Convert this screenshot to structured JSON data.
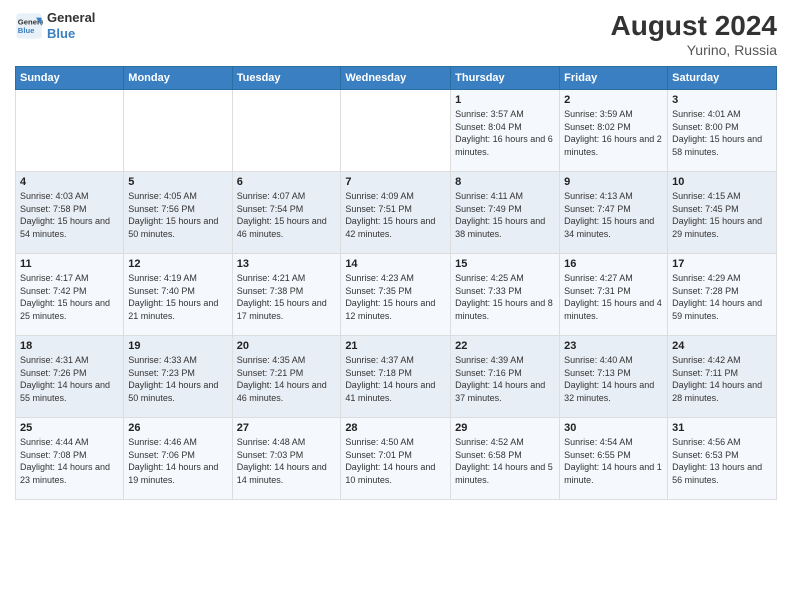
{
  "header": {
    "logo_line1": "General",
    "logo_line2": "Blue",
    "month_year": "August 2024",
    "location": "Yurino, Russia"
  },
  "days_of_week": [
    "Sunday",
    "Monday",
    "Tuesday",
    "Wednesday",
    "Thursday",
    "Friday",
    "Saturday"
  ],
  "weeks": [
    [
      {
        "day": "",
        "info": ""
      },
      {
        "day": "",
        "info": ""
      },
      {
        "day": "",
        "info": ""
      },
      {
        "day": "",
        "info": ""
      },
      {
        "day": "1",
        "info": "Sunrise: 3:57 AM\nSunset: 8:04 PM\nDaylight: 16 hours\nand 6 minutes."
      },
      {
        "day": "2",
        "info": "Sunrise: 3:59 AM\nSunset: 8:02 PM\nDaylight: 16 hours\nand 2 minutes."
      },
      {
        "day": "3",
        "info": "Sunrise: 4:01 AM\nSunset: 8:00 PM\nDaylight: 15 hours\nand 58 minutes."
      }
    ],
    [
      {
        "day": "4",
        "info": "Sunrise: 4:03 AM\nSunset: 7:58 PM\nDaylight: 15 hours\nand 54 minutes."
      },
      {
        "day": "5",
        "info": "Sunrise: 4:05 AM\nSunset: 7:56 PM\nDaylight: 15 hours\nand 50 minutes."
      },
      {
        "day": "6",
        "info": "Sunrise: 4:07 AM\nSunset: 7:54 PM\nDaylight: 15 hours\nand 46 minutes."
      },
      {
        "day": "7",
        "info": "Sunrise: 4:09 AM\nSunset: 7:51 PM\nDaylight: 15 hours\nand 42 minutes."
      },
      {
        "day": "8",
        "info": "Sunrise: 4:11 AM\nSunset: 7:49 PM\nDaylight: 15 hours\nand 38 minutes."
      },
      {
        "day": "9",
        "info": "Sunrise: 4:13 AM\nSunset: 7:47 PM\nDaylight: 15 hours\nand 34 minutes."
      },
      {
        "day": "10",
        "info": "Sunrise: 4:15 AM\nSunset: 7:45 PM\nDaylight: 15 hours\nand 29 minutes."
      }
    ],
    [
      {
        "day": "11",
        "info": "Sunrise: 4:17 AM\nSunset: 7:42 PM\nDaylight: 15 hours\nand 25 minutes."
      },
      {
        "day": "12",
        "info": "Sunrise: 4:19 AM\nSunset: 7:40 PM\nDaylight: 15 hours\nand 21 minutes."
      },
      {
        "day": "13",
        "info": "Sunrise: 4:21 AM\nSunset: 7:38 PM\nDaylight: 15 hours\nand 17 minutes."
      },
      {
        "day": "14",
        "info": "Sunrise: 4:23 AM\nSunset: 7:35 PM\nDaylight: 15 hours\nand 12 minutes."
      },
      {
        "day": "15",
        "info": "Sunrise: 4:25 AM\nSunset: 7:33 PM\nDaylight: 15 hours\nand 8 minutes."
      },
      {
        "day": "16",
        "info": "Sunrise: 4:27 AM\nSunset: 7:31 PM\nDaylight: 15 hours\nand 4 minutes."
      },
      {
        "day": "17",
        "info": "Sunrise: 4:29 AM\nSunset: 7:28 PM\nDaylight: 14 hours\nand 59 minutes."
      }
    ],
    [
      {
        "day": "18",
        "info": "Sunrise: 4:31 AM\nSunset: 7:26 PM\nDaylight: 14 hours\nand 55 minutes."
      },
      {
        "day": "19",
        "info": "Sunrise: 4:33 AM\nSunset: 7:23 PM\nDaylight: 14 hours\nand 50 minutes."
      },
      {
        "day": "20",
        "info": "Sunrise: 4:35 AM\nSunset: 7:21 PM\nDaylight: 14 hours\nand 46 minutes."
      },
      {
        "day": "21",
        "info": "Sunrise: 4:37 AM\nSunset: 7:18 PM\nDaylight: 14 hours\nand 41 minutes."
      },
      {
        "day": "22",
        "info": "Sunrise: 4:39 AM\nSunset: 7:16 PM\nDaylight: 14 hours\nand 37 minutes."
      },
      {
        "day": "23",
        "info": "Sunrise: 4:40 AM\nSunset: 7:13 PM\nDaylight: 14 hours\nand 32 minutes."
      },
      {
        "day": "24",
        "info": "Sunrise: 4:42 AM\nSunset: 7:11 PM\nDaylight: 14 hours\nand 28 minutes."
      }
    ],
    [
      {
        "day": "25",
        "info": "Sunrise: 4:44 AM\nSunset: 7:08 PM\nDaylight: 14 hours\nand 23 minutes."
      },
      {
        "day": "26",
        "info": "Sunrise: 4:46 AM\nSunset: 7:06 PM\nDaylight: 14 hours\nand 19 minutes."
      },
      {
        "day": "27",
        "info": "Sunrise: 4:48 AM\nSunset: 7:03 PM\nDaylight: 14 hours\nand 14 minutes."
      },
      {
        "day": "28",
        "info": "Sunrise: 4:50 AM\nSunset: 7:01 PM\nDaylight: 14 hours\nand 10 minutes."
      },
      {
        "day": "29",
        "info": "Sunrise: 4:52 AM\nSunset: 6:58 PM\nDaylight: 14 hours\nand 5 minutes."
      },
      {
        "day": "30",
        "info": "Sunrise: 4:54 AM\nSunset: 6:55 PM\nDaylight: 14 hours\nand 1 minute."
      },
      {
        "day": "31",
        "info": "Sunrise: 4:56 AM\nSunset: 6:53 PM\nDaylight: 13 hours\nand 56 minutes."
      }
    ]
  ]
}
